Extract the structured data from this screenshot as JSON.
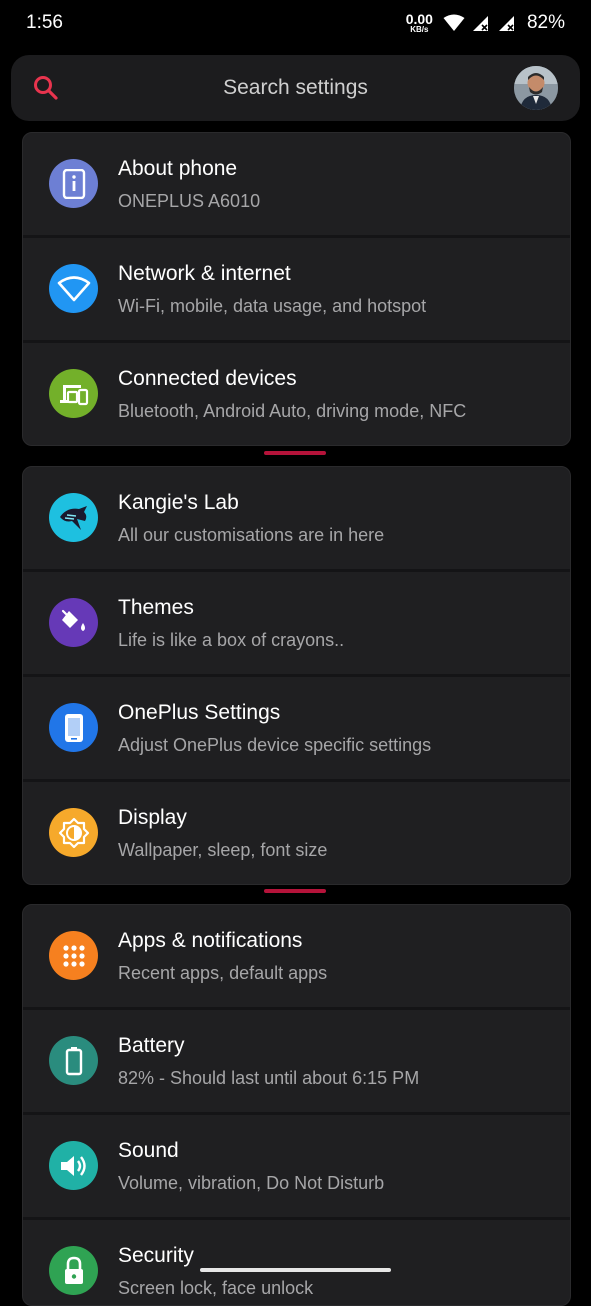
{
  "status_bar": {
    "time": "1:56",
    "net_speed_value": "0.00",
    "net_speed_unit": "KB/s",
    "battery": "82%"
  },
  "search": {
    "placeholder": "Search settings",
    "accent_color": "#e8344e"
  },
  "groups": [
    {
      "items": [
        {
          "title": "About phone",
          "subtitle": "ONEPLUS A6010",
          "icon": "phone-info-icon",
          "color": "#5c6bc0"
        },
        {
          "title": "Network & internet",
          "subtitle": "Wi-Fi, mobile, data usage, and hotspot",
          "icon": "wifi-icon",
          "color": "#1e88e5"
        },
        {
          "title": "Connected devices",
          "subtitle": "Bluetooth, Android Auto, driving mode, NFC",
          "icon": "devices-icon",
          "color": "#6aaa1e"
        }
      ]
    },
    {
      "items": [
        {
          "title": "Kangie's Lab",
          "subtitle": "All our customisations are in here",
          "icon": "kangie-logo-icon",
          "color": "#00b8d4"
        },
        {
          "title": "Themes",
          "subtitle": "Life is like a box of crayons..",
          "icon": "paint-bucket-icon",
          "color": "#5e35b1"
        },
        {
          "title": "OnePlus Settings",
          "subtitle": "Adjust OnePlus device specific settings",
          "icon": "oneplus-device-icon",
          "color": "#1e6ee0"
        },
        {
          "title": "Display",
          "subtitle": "Wallpaper, sleep, font size",
          "icon": "brightness-icon",
          "color": "#f5a623"
        }
      ]
    },
    {
      "items": [
        {
          "title": "Apps & notifications",
          "subtitle": "Recent apps, default apps",
          "icon": "apps-grid-icon",
          "color": "#f57c1f"
        },
        {
          "title": "Battery",
          "subtitle": "82% - Should last until about 6:15 PM",
          "icon": "battery-icon",
          "color": "#26897a"
        },
        {
          "title": "Sound",
          "subtitle": "Volume, vibration, Do Not Disturb",
          "icon": "volume-icon",
          "color": "#1eaaa0"
        },
        {
          "title": "Security",
          "subtitle": "Screen lock, face unlock",
          "icon": "lock-icon",
          "color": "#2e9d4e"
        }
      ]
    }
  ]
}
